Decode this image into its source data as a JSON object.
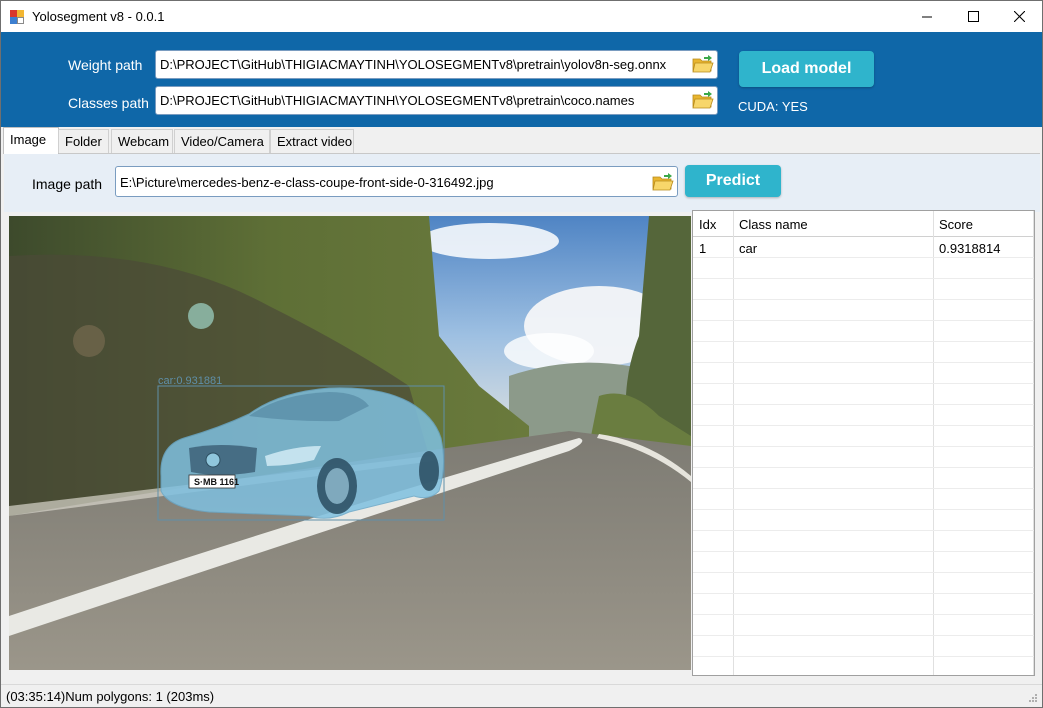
{
  "window": {
    "title": "Yolosegment v8 - 0.0.1"
  },
  "header": {
    "weight_label": "Weight path",
    "weight_value": "D:\\PROJECT\\GitHub\\THIGIACMAYTINH\\YOLOSEGMENTv8\\pretrain\\yolov8n-seg.onnx",
    "classes_label": "Classes path",
    "classes_value": "D:\\PROJECT\\GitHub\\THIGIACMAYTINH\\YOLOSEGMENTv8\\pretrain\\coco.names",
    "load_button": "Load model",
    "cuda_status": "CUDA: YES"
  },
  "tabs": [
    {
      "label": "Image",
      "active": true
    },
    {
      "label": "Folder",
      "active": false
    },
    {
      "label": "Webcam",
      "active": false
    },
    {
      "label": "Video/Camera",
      "active": false
    },
    {
      "label": "Extract video",
      "active": false
    }
  ],
  "image_tab": {
    "image_label": "Image path",
    "image_value": "E:\\Picture\\mercedes-benz-e-class-coupe-front-side-0-316492.jpg",
    "predict_button": "Predict",
    "detection_label": "car:0.931881",
    "plate_text": "S·MB 1161"
  },
  "results_grid": {
    "columns": [
      "Idx",
      "Class name",
      "Score"
    ],
    "rows": [
      {
        "idx": "1",
        "class_name": "car",
        "score": "0.9318814"
      }
    ]
  },
  "status": {
    "text": "(03:35:14)Num polygons: 1 (203ms)"
  },
  "colors": {
    "header_bg": "#0f67a8",
    "button_bg": "#2fb4cc",
    "mask": "#7fc0e0"
  },
  "icons": [
    "app-icon",
    "minimize-icon",
    "maximize-icon",
    "close-icon",
    "folder-open-icon",
    "resize-grip-icon"
  ]
}
